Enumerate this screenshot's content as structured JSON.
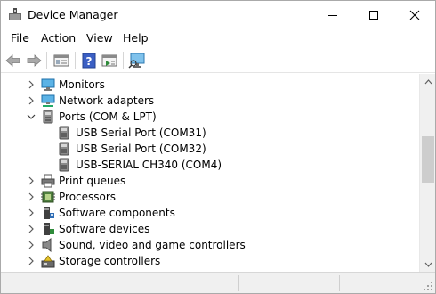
{
  "window": {
    "title": "Device Manager"
  },
  "menu": {
    "file": "File",
    "action": "Action",
    "view": "View",
    "help": "Help"
  },
  "toolbar": {
    "icons": [
      "back-arrow-icon",
      "forward-arrow-icon",
      "properties-icon",
      "help-icon",
      "update-driver-icon",
      "scan-hardware-icon"
    ]
  },
  "tree": {
    "items": [
      {
        "label": "Monitors",
        "icon": "monitor-icon",
        "expanded": false,
        "level": 1
      },
      {
        "label": "Network adapters",
        "icon": "network-adapter-icon",
        "expanded": false,
        "level": 1
      },
      {
        "label": "Ports (COM & LPT)",
        "icon": "port-icon",
        "expanded": true,
        "level": 1
      },
      {
        "label": "USB Serial Port (COM31)",
        "icon": "port-icon",
        "level": 2
      },
      {
        "label": "USB Serial Port (COM32)",
        "icon": "port-icon",
        "level": 2
      },
      {
        "label": "USB-SERIAL CH340 (COM4)",
        "icon": "port-icon",
        "level": 2
      },
      {
        "label": "Print queues",
        "icon": "printer-icon",
        "expanded": false,
        "level": 1
      },
      {
        "label": "Processors",
        "icon": "processor-icon",
        "expanded": false,
        "level": 1
      },
      {
        "label": "Software components",
        "icon": "software-component-icon",
        "expanded": false,
        "level": 1
      },
      {
        "label": "Software devices",
        "icon": "software-device-icon",
        "expanded": false,
        "level": 1
      },
      {
        "label": "Sound, video and game controllers",
        "icon": "speaker-icon",
        "expanded": false,
        "level": 1
      },
      {
        "label": "Storage controllers",
        "icon": "storage-controller-icon",
        "expanded": false,
        "level": 1
      }
    ]
  },
  "colors": {
    "accent": "#0078d7",
    "selection": "#cce8ff"
  }
}
